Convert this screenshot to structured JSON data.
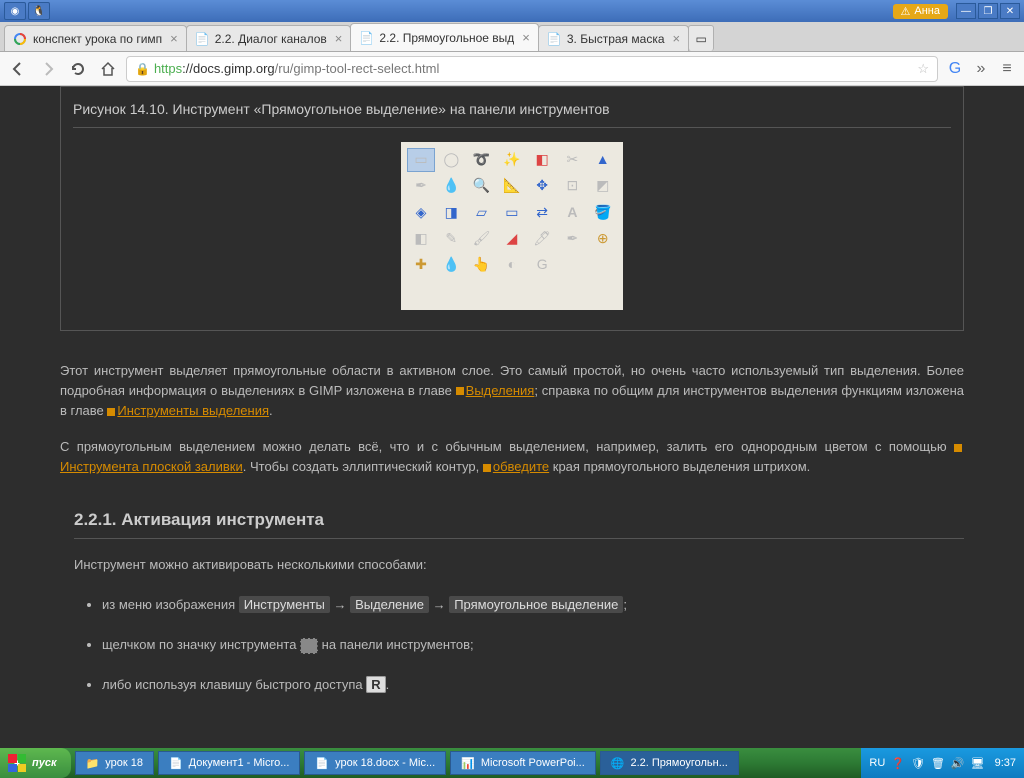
{
  "titlebar": {
    "user": "Анна"
  },
  "tabs": [
    {
      "label": "конспект урока по гимп",
      "favicon": "google"
    },
    {
      "label": "2.2. Диалог каналов",
      "favicon": "page"
    },
    {
      "label": "2.2. Прямоугольное выд",
      "favicon": "page",
      "active": true
    },
    {
      "label": "3. Быстрая маска",
      "favicon": "page"
    }
  ],
  "url": {
    "scheme": "https",
    "host": "://docs.gimp.org",
    "path": "/ru/gimp-tool-rect-select.html"
  },
  "figure": {
    "title": "Рисунок 14.10. Инструмент «Прямоугольное выделение» на панели инструментов"
  },
  "para1": {
    "t1": "Этот инструмент выделяет прямоугольные области в активном слое. Это самый простой, но очень часто используемый тип выделения. Более подробная информация о выделениях в GIMP изложена в главе ",
    "link1": "Выделения",
    "t2": "; справка по общим для инструментов выделения функциям изложена в главе ",
    "link2": "Инструменты выделения",
    "t3": "."
  },
  "para2": {
    "t1": "С прямоугольным выделением можно делать всё, что и с обычным выделением, например, залить его однородным цветом с помощью ",
    "link1": "Инструмента плоской заливки",
    "t2": ". Чтобы создать эллиптический контур, ",
    "link2": "обведите",
    "t3": " края прямоугольного выделения штрихом."
  },
  "section": {
    "title": "2.2.1. Активация инструмента",
    "intro": "Инструмент можно активировать несколькими способами:",
    "li1": {
      "a": "из меню изображения ",
      "m1": "Инструменты",
      "arr": " → ",
      "m2": "Выделение",
      "m3": "Прямоугольное выделение",
      "end": ";"
    },
    "li2": {
      "a": "щелчком по значку инструмента ",
      "b": " на панели инструментов;"
    },
    "li3": {
      "a": "либо используя клавишу быстрого доступа ",
      "key": "R",
      "b": "."
    }
  },
  "taskbar": {
    "start": "пуск",
    "items": [
      "урок 18",
      "Документ1 - Micro...",
      "урок 18.docx - Mic...",
      "Microsoft PowerPoi...",
      "2.2. Прямоугольн..."
    ],
    "lang": "RU",
    "time": "9:37"
  }
}
